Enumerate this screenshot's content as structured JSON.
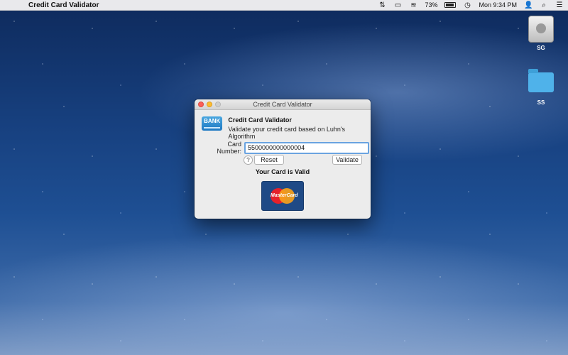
{
  "menubar": {
    "app_name": "Credit Card Validator",
    "battery": "73%",
    "clock": "Mon 9:34 PM",
    "icons": [
      "apple-icon",
      "sync-icon",
      "airplay-icon",
      "wifi-icon",
      "battery-icon",
      "time-machine-icon",
      "user-icon",
      "spotlight-icon",
      "menu-icon"
    ]
  },
  "desktop": {
    "items": [
      {
        "label": "SG",
        "icon": "hard-drive-icon"
      },
      {
        "label": "SS",
        "icon": "folder-icon"
      }
    ]
  },
  "window": {
    "title": "Credit Card Validator",
    "header_title": "Credit Card Validator",
    "header_subtitle": "Validate your credit card based on Luhn's Algorithm",
    "logo_text": "BANK",
    "card_label": "Card Number:",
    "card_value": "5500000000000004",
    "help_label": "?",
    "reset_label": "Reset",
    "validate_label": "Validate",
    "result_text": "Your Card is Valid",
    "card_brand": "MasterCard"
  },
  "colors": {
    "mastercard_red": "#e5212b",
    "mastercard_orange": "#f7a11b",
    "card_bg": "#1f4a86",
    "focus_ring": "#6aa3e0"
  }
}
